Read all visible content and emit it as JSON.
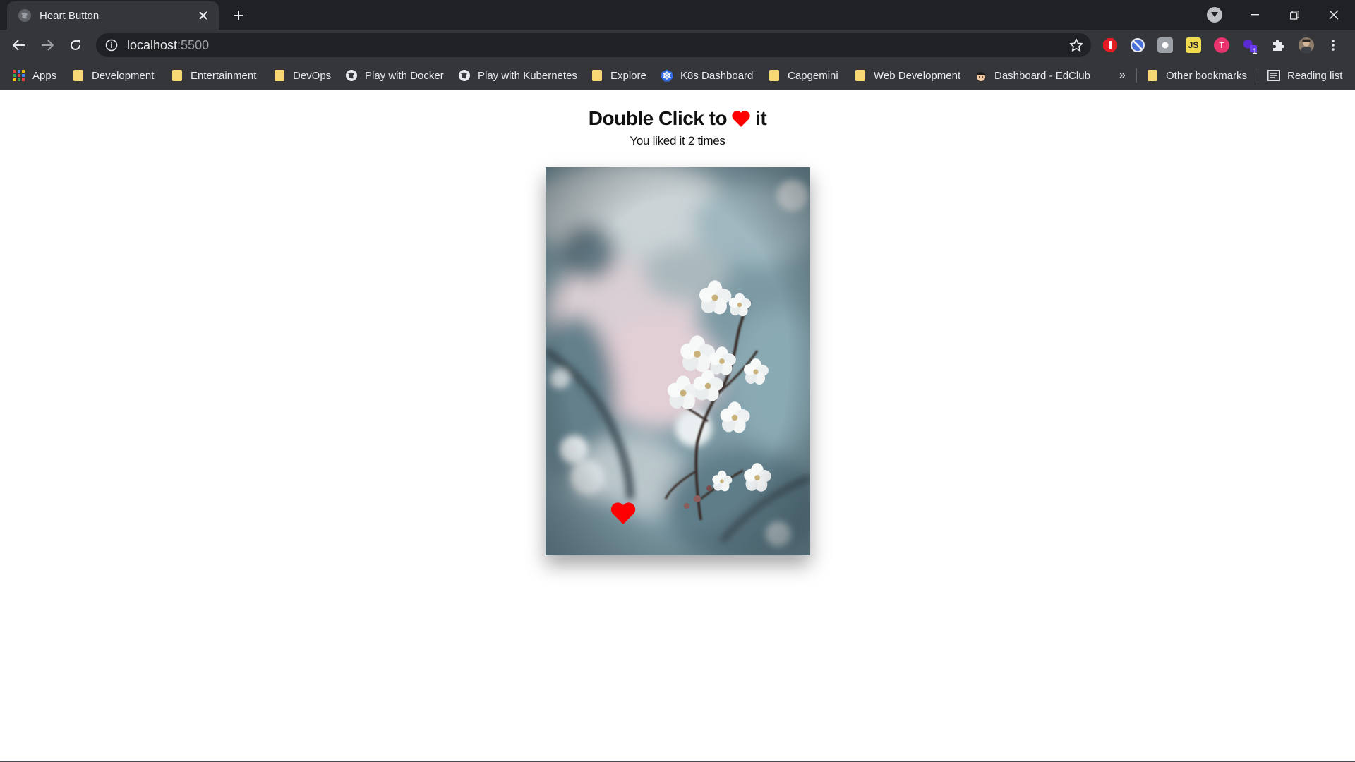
{
  "browser": {
    "tab_title": "Heart Button",
    "url_host": "localhost",
    "url_port": ":5500",
    "bookmarks": [
      {
        "label": "Apps",
        "icon": "apps-grid-icon"
      },
      {
        "label": "Development",
        "icon": "folder-icon"
      },
      {
        "label": "Entertainment",
        "icon": "folder-icon"
      },
      {
        "label": "DevOps",
        "icon": "folder-icon"
      },
      {
        "label": "Play with Docker",
        "icon": "globe-icon"
      },
      {
        "label": "Play with Kubernetes",
        "icon": "globe-icon"
      },
      {
        "label": "Explore",
        "icon": "folder-icon"
      },
      {
        "label": "K8s Dashboard",
        "icon": "kubernetes-icon"
      },
      {
        "label": "Capgemini",
        "icon": "folder-icon"
      },
      {
        "label": "Web Development",
        "icon": "folder-icon"
      },
      {
        "label": "Dashboard - EdClub",
        "icon": "edclub-icon"
      }
    ],
    "overflow_label": "»",
    "other_bookmarks": "Other bookmarks",
    "reading_list": "Reading list",
    "extension_badge": "1"
  },
  "page": {
    "title_before": "Double Click to",
    "title_after": "it",
    "likes_prefix": "You liked it",
    "likes_count": "2",
    "likes_suffix": "times",
    "heart_color": "#ff0000"
  }
}
